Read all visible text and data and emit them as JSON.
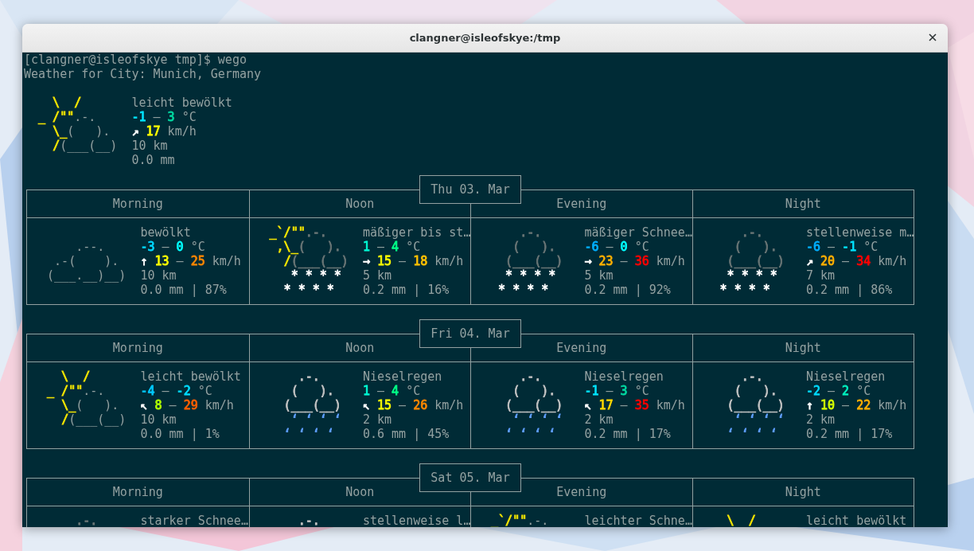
{
  "window": {
    "title": "clangner@isleofskye:/tmp"
  },
  "terminal": {
    "lines": [
      "[clangner@isleofskye tmp]$ wego",
      "Weather for City: Munich, Germany"
    ],
    "current": {
      "art": [
        {
          "text": "    \\  /\n  _ /\"\"",
          "color": "#f2e400"
        },
        {
          "text": ".-.\n    "
        },
        {
          "text": "\\_",
          "color": "#f2e400"
        },
        {
          "text": "(   ).\n    "
        },
        {
          "text": "/",
          "color": "#f2e400"
        },
        {
          "text": "(___(__)"
        }
      ],
      "info": [
        [
          {
            "text": "leicht bewölkt"
          }
        ],
        [
          {
            "text": "-1",
            "color": "#00e4ff"
          },
          {
            "text": " – "
          },
          {
            "text": "3",
            "color": "#00d7a0"
          },
          {
            "text": " °C"
          }
        ],
        [
          {
            "text": "↗ ",
            "color": "#ffffff"
          },
          {
            "text": "17",
            "color": "#ffff00"
          },
          {
            "text": " km/h"
          }
        ],
        [
          {
            "text": "10 km"
          }
        ],
        [
          {
            "text": "0.0 mm"
          }
        ]
      ]
    },
    "days": [
      {
        "date": "Thu 03. Mar",
        "periods": [
          {
            "name": "Morning",
            "art": [
              {
                "text": "\n      .--.\n   .-(    ).\n  (___.__)__)"
              }
            ],
            "info": [
              [
                {
                  "text": "bewölkt"
                }
              ],
              [
                {
                  "text": "-3",
                  "color": "#00d7ff"
                },
                {
                  "text": " – "
                },
                {
                  "text": "0",
                  "color": "#00ffff"
                },
                {
                  "text": " °C"
                }
              ],
              [
                {
                  "text": "↑ ",
                  "color": "#ffffff"
                },
                {
                  "text": "13",
                  "color": "#ffff00"
                },
                {
                  "text": " – "
                },
                {
                  "text": "25",
                  "color": "#ff8700"
                },
                {
                  "text": " km/h"
                }
              ],
              [
                {
                  "text": "10 km"
                }
              ],
              [
                {
                  "text": "0.0 mm | 87%"
                }
              ]
            ]
          },
          {
            "name": "Noon",
            "art": [
              {
                "text": "  _`/\"\"",
                "color": "#f2e400"
              },
              {
                "text": ".-.\n   ",
                "color": "#6a7676"
              },
              {
                "text": ",\\_",
                "color": "#f2e400"
              },
              {
                "text": "(   ).\n    ",
                "color": "#6a7676"
              },
              {
                "text": "/",
                "color": "#f2e400"
              },
              {
                "text": "(___(__)\n",
                "color": "#6a7676"
              },
              {
                "text": "     * * * *\n    * * * *",
                "color": "#ffffff"
              }
            ],
            "info": [
              [
                {
                  "text": "mäßiger bis st…"
                }
              ],
              [
                {
                  "text": "1",
                  "color": "#00ffd7"
                },
                {
                  "text": " – "
                },
                {
                  "text": "4",
                  "color": "#00ff87"
                },
                {
                  "text": " °C"
                }
              ],
              [
                {
                  "text": "→ ",
                  "color": "#ffffff"
                },
                {
                  "text": "15",
                  "color": "#ffff00"
                },
                {
                  "text": " – "
                },
                {
                  "text": "18",
                  "color": "#ffc000"
                },
                {
                  "text": " km/h"
                }
              ],
              [
                {
                  "text": "5 km"
                }
              ],
              [
                {
                  "text": "0.2 mm | 16%"
                }
              ]
            ]
          },
          {
            "name": "Evening",
            "art": [
              {
                "text": "      .-.\n     (   ).\n    (___(__)\n",
                "color": "#6a7676"
              },
              {
                "text": "    * * * *\n   * * * *",
                "color": "#ffffff"
              }
            ],
            "info": [
              [
                {
                  "text": "mäßiger Schnee…"
                }
              ],
              [
                {
                  "text": "-6",
                  "color": "#00afff"
                },
                {
                  "text": " – "
                },
                {
                  "text": "0",
                  "color": "#00ffff"
                },
                {
                  "text": " °C"
                }
              ],
              [
                {
                  "text": "→ ",
                  "color": "#ffffff"
                },
                {
                  "text": "23",
                  "color": "#ffaf00"
                },
                {
                  "text": " – "
                },
                {
                  "text": "36",
                  "color": "#ff0000"
                },
                {
                  "text": " km/h"
                }
              ],
              [
                {
                  "text": "5 km"
                }
              ],
              [
                {
                  "text": "0.2 mm | 92%"
                }
              ]
            ]
          },
          {
            "name": "Night",
            "art": [
              {
                "text": "      .-.\n     (   ).\n    (___(__)\n",
                "color": "#6a7676"
              },
              {
                "text": "    * * * *\n   * * * *",
                "color": "#ffffff"
              }
            ],
            "info": [
              [
                {
                  "text": "stellenweise m…"
                }
              ],
              [
                {
                  "text": "-6",
                  "color": "#00afff"
                },
                {
                  "text": " – "
                },
                {
                  "text": "-1",
                  "color": "#00e4ff"
                },
                {
                  "text": " °C"
                }
              ],
              [
                {
                  "text": "↗ ",
                  "color": "#ffffff"
                },
                {
                  "text": "20",
                  "color": "#ffaf00"
                },
                {
                  "text": " – "
                },
                {
                  "text": "34",
                  "color": "#ff0000"
                },
                {
                  "text": " km/h"
                }
              ],
              [
                {
                  "text": "7 km"
                }
              ],
              [
                {
                  "text": "0.2 mm | 86%"
                }
              ]
            ]
          }
        ]
      },
      {
        "date": "Fri 04. Mar",
        "periods": [
          {
            "name": "Morning",
            "art": [
              {
                "text": "    \\  /\n  _ /\"\"",
                "color": "#f2e400"
              },
              {
                "text": ".-.\n    "
              },
              {
                "text": "\\_",
                "color": "#f2e400"
              },
              {
                "text": "(   ).\n    "
              },
              {
                "text": "/",
                "color": "#f2e400"
              },
              {
                "text": "(___(__)"
              }
            ],
            "info": [
              [
                {
                  "text": "leicht bewölkt"
                }
              ],
              [
                {
                  "text": "-4",
                  "color": "#00c8ff"
                },
                {
                  "text": " – "
                },
                {
                  "text": "-2",
                  "color": "#00dcff"
                },
                {
                  "text": " °C"
                }
              ],
              [
                {
                  "text": "↖ ",
                  "color": "#ffffff"
                },
                {
                  "text": "8",
                  "color": "#afff00"
                },
                {
                  "text": " – "
                },
                {
                  "text": "29",
                  "color": "#ff5f00"
                },
                {
                  "text": " km/h"
                }
              ],
              [
                {
                  "text": "10 km"
                }
              ],
              [
                {
                  "text": "0.0 mm | 1%"
                }
              ]
            ]
          },
          {
            "name": "Noon",
            "art": [
              {
                "text": "      .-.\n     (   ).\n    (___(__)\n",
                "color": "#c4c4c4"
              },
              {
                "text": "     ‘ ‘ ‘ ‘\n    ‘ ‘ ‘ ‘",
                "color": "#5f9fff"
              }
            ],
            "info": [
              [
                {
                  "text": "Nieselregen"
                }
              ],
              [
                {
                  "text": "1",
                  "color": "#00ffd7"
                },
                {
                  "text": " – "
                },
                {
                  "text": "4",
                  "color": "#00ff87"
                },
                {
                  "text": " °C"
                }
              ],
              [
                {
                  "text": "↖ ",
                  "color": "#ffffff"
                },
                {
                  "text": "15",
                  "color": "#ffff00"
                },
                {
                  "text": " – "
                },
                {
                  "text": "26",
                  "color": "#ff8700"
                },
                {
                  "text": " km/h"
                }
              ],
              [
                {
                  "text": "2 km"
                }
              ],
              [
                {
                  "text": "0.6 mm | 45%"
                }
              ]
            ]
          },
          {
            "name": "Evening",
            "art": [
              {
                "text": "      .-.\n     (   ).\n    (___(__)\n",
                "color": "#c4c4c4"
              },
              {
                "text": "     ‘ ‘ ‘ ‘\n    ‘ ‘ ‘ ‘",
                "color": "#5f9fff"
              }
            ],
            "info": [
              [
                {
                  "text": "Nieselregen"
                }
              ],
              [
                {
                  "text": "-1",
                  "color": "#00e4ff"
                },
                {
                  "text": " – "
                },
                {
                  "text": "3",
                  "color": "#00d7a0"
                },
                {
                  "text": " °C"
                }
              ],
              [
                {
                  "text": "↖ ",
                  "color": "#ffffff"
                },
                {
                  "text": "17",
                  "color": "#ffd700"
                },
                {
                  "text": " – "
                },
                {
                  "text": "35",
                  "color": "#ff0000"
                },
                {
                  "text": " km/h"
                }
              ],
              [
                {
                  "text": "2 km"
                }
              ],
              [
                {
                  "text": "0.2 mm | 17%"
                }
              ]
            ]
          },
          {
            "name": "Night",
            "art": [
              {
                "text": "      .-.\n     (   ).\n    (___(__)\n",
                "color": "#c4c4c4"
              },
              {
                "text": "     ‘ ‘ ‘ ‘\n    ‘ ‘ ‘ ‘",
                "color": "#5f9fff"
              }
            ],
            "info": [
              [
                {
                  "text": "Nieselregen"
                }
              ],
              [
                {
                  "text": "-2",
                  "color": "#00dcff"
                },
                {
                  "text": " – "
                },
                {
                  "text": "2",
                  "color": "#00f0bf"
                },
                {
                  "text": " °C"
                }
              ],
              [
                {
                  "text": "↑ ",
                  "color": "#ffffff"
                },
                {
                  "text": "10",
                  "color": "#d7ff00"
                },
                {
                  "text": " – "
                },
                {
                  "text": "22",
                  "color": "#ffaf00"
                },
                {
                  "text": " km/h"
                }
              ],
              [
                {
                  "text": "2 km"
                }
              ],
              [
                {
                  "text": "0.2 mm | 17%"
                }
              ]
            ]
          }
        ]
      },
      {
        "date": "Sat 05. Mar",
        "periods": [
          {
            "name": "Morning",
            "art": [
              {
                "text": "      .-.",
                "color": "#6a7676"
              }
            ],
            "info": [
              [
                {
                  "text": "starker Schnee…"
                }
              ]
            ]
          },
          {
            "name": "Noon",
            "art": [
              {
                "text": "      .-.",
                "color": "#c4c4c4"
              }
            ],
            "info": [
              [
                {
                  "text": "stellenweise l…"
                }
              ]
            ]
          },
          {
            "name": "Evening",
            "art": [
              {
                "text": "  _`/\"\"",
                "color": "#f2e400"
              },
              {
                "text": ".-."
              }
            ],
            "info": [
              [
                {
                  "text": "leichter Schne…"
                }
              ]
            ]
          },
          {
            "name": "Night",
            "art": [
              {
                "text": "    \\  /",
                "color": "#f2e400"
              }
            ],
            "info": [
              [
                {
                  "text": "leicht bewölkt"
                }
              ]
            ]
          }
        ]
      }
    ]
  }
}
